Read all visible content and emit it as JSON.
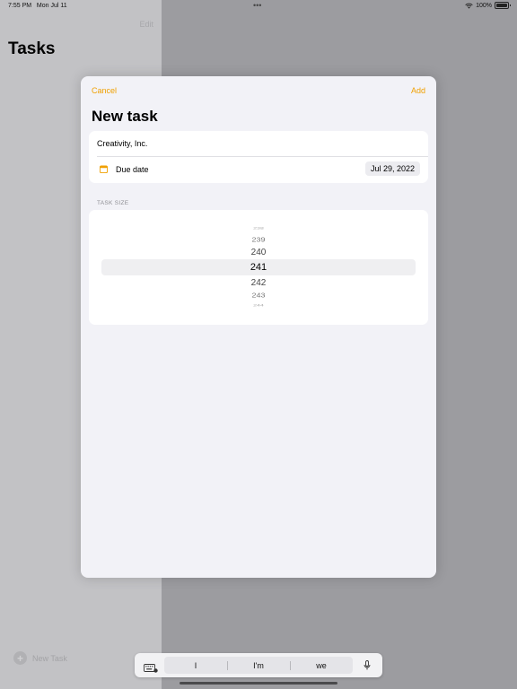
{
  "status_bar": {
    "time": "7:55 PM",
    "date": "Mon Jul 11",
    "multitask_dots": "•••",
    "battery": "100%"
  },
  "sidebar": {
    "edit_label": "Edit",
    "title": "Tasks",
    "new_task_label": "New Task"
  },
  "sheet": {
    "cancel_label": "Cancel",
    "add_label": "Add",
    "title": "New task",
    "name_value": "Creativity, Inc.",
    "due_date_label": "Due date",
    "due_date_value": "Jul 29, 2022",
    "task_size_label": "TASK SIZE",
    "picker": {
      "rows": [
        "238",
        "239",
        "240",
        "241",
        "242",
        "243",
        "244"
      ],
      "selected": "241"
    }
  },
  "keyboard_bar": {
    "suggestions": [
      "I",
      "I'm",
      "we"
    ]
  },
  "colors": {
    "accent": "#f0a000",
    "sheet_background": "#f2f2f7",
    "dim_overlay": "#9c9ca0"
  }
}
